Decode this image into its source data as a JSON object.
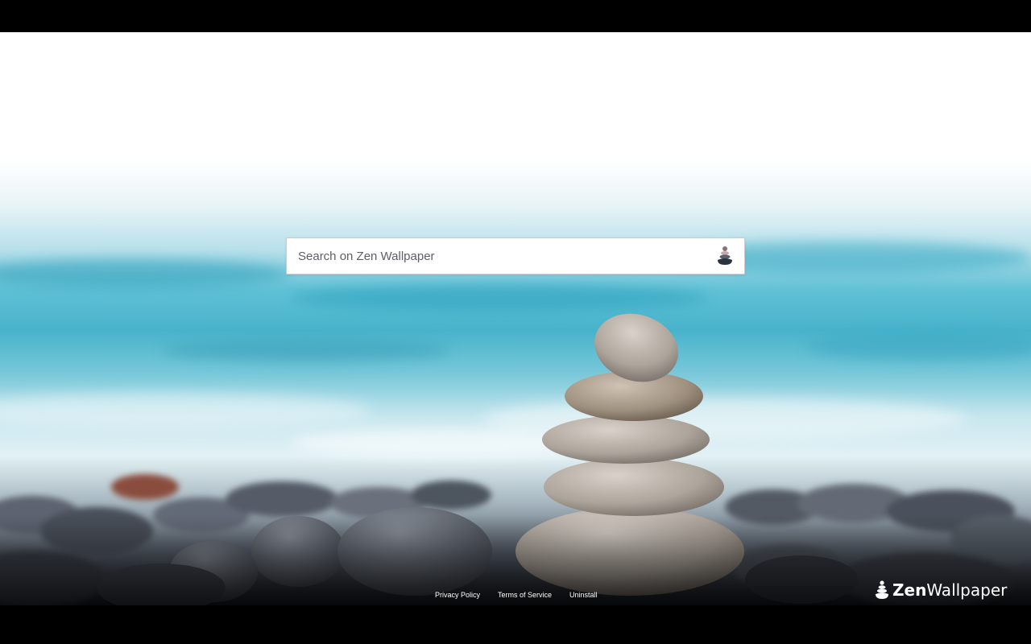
{
  "search": {
    "placeholder": "Search on Zen Wallpaper"
  },
  "footer": {
    "privacy": "Privacy Policy",
    "terms": "Terms of Service",
    "uninstall": "Uninstall"
  },
  "brand": {
    "part1": "Zen",
    "part2": "Wallpaper"
  },
  "icons": {
    "search_button": "stone-stack-icon",
    "logo": "stone-stack-logo-icon"
  },
  "colors": {
    "sea": "#4fb9cf",
    "sky": "#ffffff",
    "pebbles": "#545964",
    "stones": "#b3aba3"
  }
}
